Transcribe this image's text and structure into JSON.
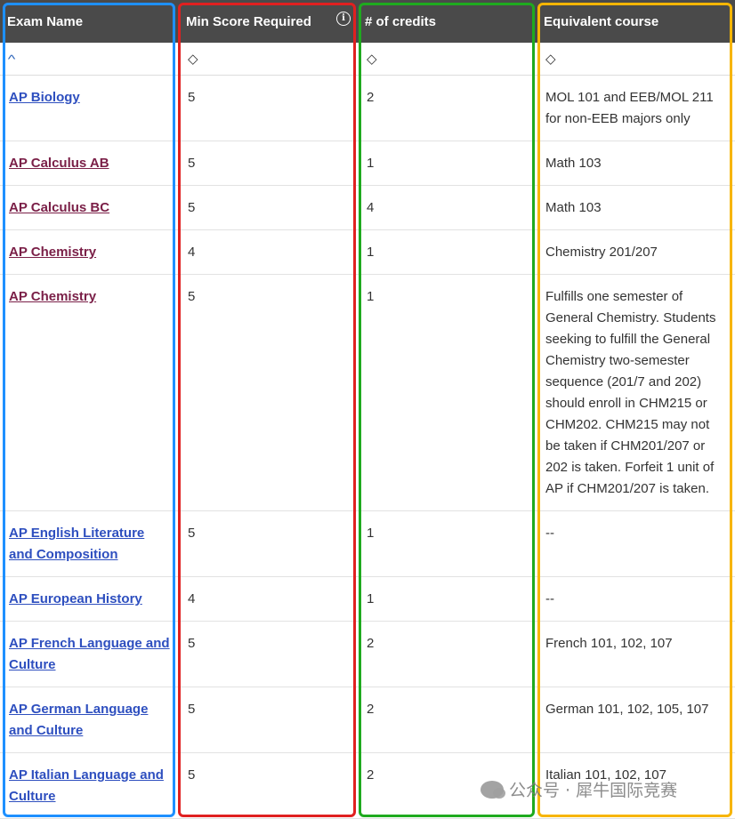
{
  "headers": {
    "exam_name": "Exam Name",
    "min_score": "Min Score Required",
    "credits": "# of credits",
    "equivalent": "Equivalent course"
  },
  "sort": {
    "exam_name": "^",
    "min_score": "◇",
    "credits": "◇",
    "equivalent": "◇"
  },
  "rows": [
    {
      "exam": "AP Biology",
      "score": "5",
      "credits": "2",
      "equivalent": "MOL 101 and EEB/MOL 211 for non-EEB majors only",
      "visited": false
    },
    {
      "exam": "AP Calculus AB",
      "score": "5",
      "credits": "1",
      "equivalent": "Math 103",
      "visited": true
    },
    {
      "exam": "AP Calculus BC",
      "score": "5",
      "credits": "4",
      "equivalent": "Math 103",
      "visited": true
    },
    {
      "exam": "AP Chemistry",
      "score": "4",
      "credits": "1",
      "equivalent": "Chemistry 201/207",
      "visited": true
    },
    {
      "exam": "AP Chemistry",
      "score": "5",
      "credits": "1",
      "equivalent": "Fulfills one semester of General Chemistry. Students seeking to fulfill the General Chemistry two-semester sequence (201/7 and 202) should enroll in CHM215 or CHM202. CHM215 may not be taken if CHM201/207 or 202 is taken. Forfeit 1 unit of AP if CHM201/207 is taken.",
      "visited": true
    },
    {
      "exam": "AP English Literature and Composition",
      "score": "5",
      "credits": "1",
      "equivalent": "--",
      "visited": false
    },
    {
      "exam": "AP European History",
      "score": "4",
      "credits": "1",
      "equivalent": "--",
      "visited": false
    },
    {
      "exam": "AP French Language and Culture",
      "score": "5",
      "credits": "2",
      "equivalent": "French 101, 102, 107",
      "visited": false
    },
    {
      "exam": "AP German Language and Culture",
      "score": "5",
      "credits": "2",
      "equivalent": "German 101, 102, 105, 107",
      "visited": false
    },
    {
      "exam": "AP Italian Language and Culture",
      "score": "5",
      "credits": "2",
      "equivalent": "Italian 101, 102, 107",
      "visited": false
    }
  ],
  "watermark": "公众号 · 犀牛国际竞赛",
  "colors": {
    "header_bg": "#4a4a4a",
    "link": "#2e4fbf",
    "link_visited": "#7a1f47",
    "box_exam": "#1e90ff",
    "box_score": "#e02020",
    "box_credits": "#1faa1f",
    "box_equivalent": "#f7b500"
  }
}
